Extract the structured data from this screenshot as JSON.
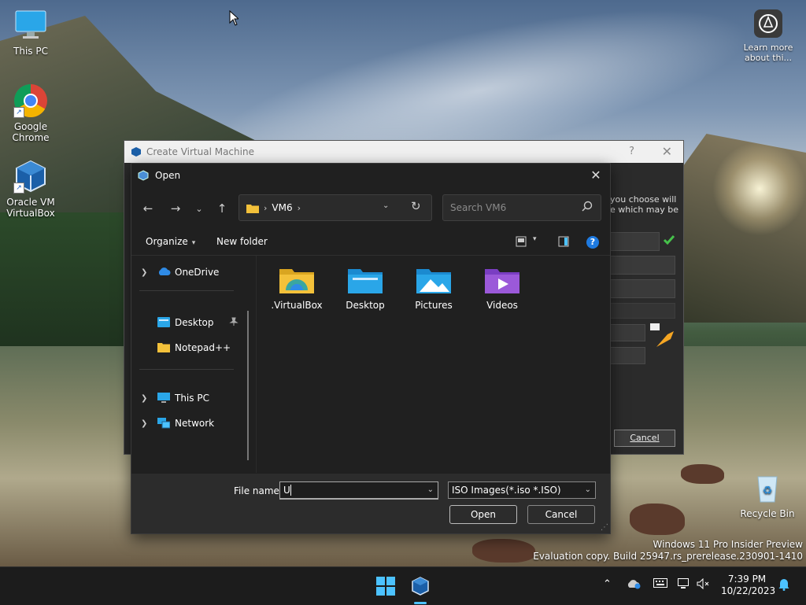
{
  "desktop": {
    "icons": [
      {
        "label": "This PC"
      },
      {
        "label": "Google Chrome"
      },
      {
        "label": "Oracle VM VirtualBox"
      },
      {
        "label": "Recycle Bin"
      }
    ],
    "learn_more_label": "Learn more about thi...",
    "watermark_line1": "Windows 11 Pro Insider Preview",
    "watermark_line2": "Evaluation copy. Build 25947.rs_prerelease.230901-1410"
  },
  "vm_window": {
    "title": "Create Virtual Machine",
    "help_glyph": "?",
    "close_glyph": "✕",
    "partial_text_1": "you choose will",
    "partial_text_2": "e which may be",
    "cancel_label": "Cancel"
  },
  "open_dialog": {
    "title": "Open",
    "address": {
      "crumb": "VM6"
    },
    "search": {
      "placeholder": "Search VM6"
    },
    "commands": {
      "organize": "Organize",
      "new_folder": "New folder"
    },
    "sidebar": [
      {
        "label": "OneDrive"
      },
      {
        "label": "Desktop"
      },
      {
        "label": "Notepad++"
      },
      {
        "label": "This PC"
      },
      {
        "label": "Network"
      }
    ],
    "folders": [
      {
        "name": ".VirtualBox"
      },
      {
        "name": "Desktop"
      },
      {
        "name": "Pictures"
      },
      {
        "name": "Videos"
      }
    ],
    "file_name_label": "File name:",
    "file_name_value": "U",
    "filter_value": "ISO Images(*.iso *.ISO)",
    "open_label": "Open",
    "cancel_label": "Cancel"
  },
  "taskbar": {
    "time": "7:39 PM",
    "date": "10/22/2023"
  },
  "colors": {
    "accent": "#1e7ae0",
    "dialog_bg": "#202020",
    "taskbar_bg": "#1c1c1c",
    "folder_yellow": "#f3c13a"
  }
}
